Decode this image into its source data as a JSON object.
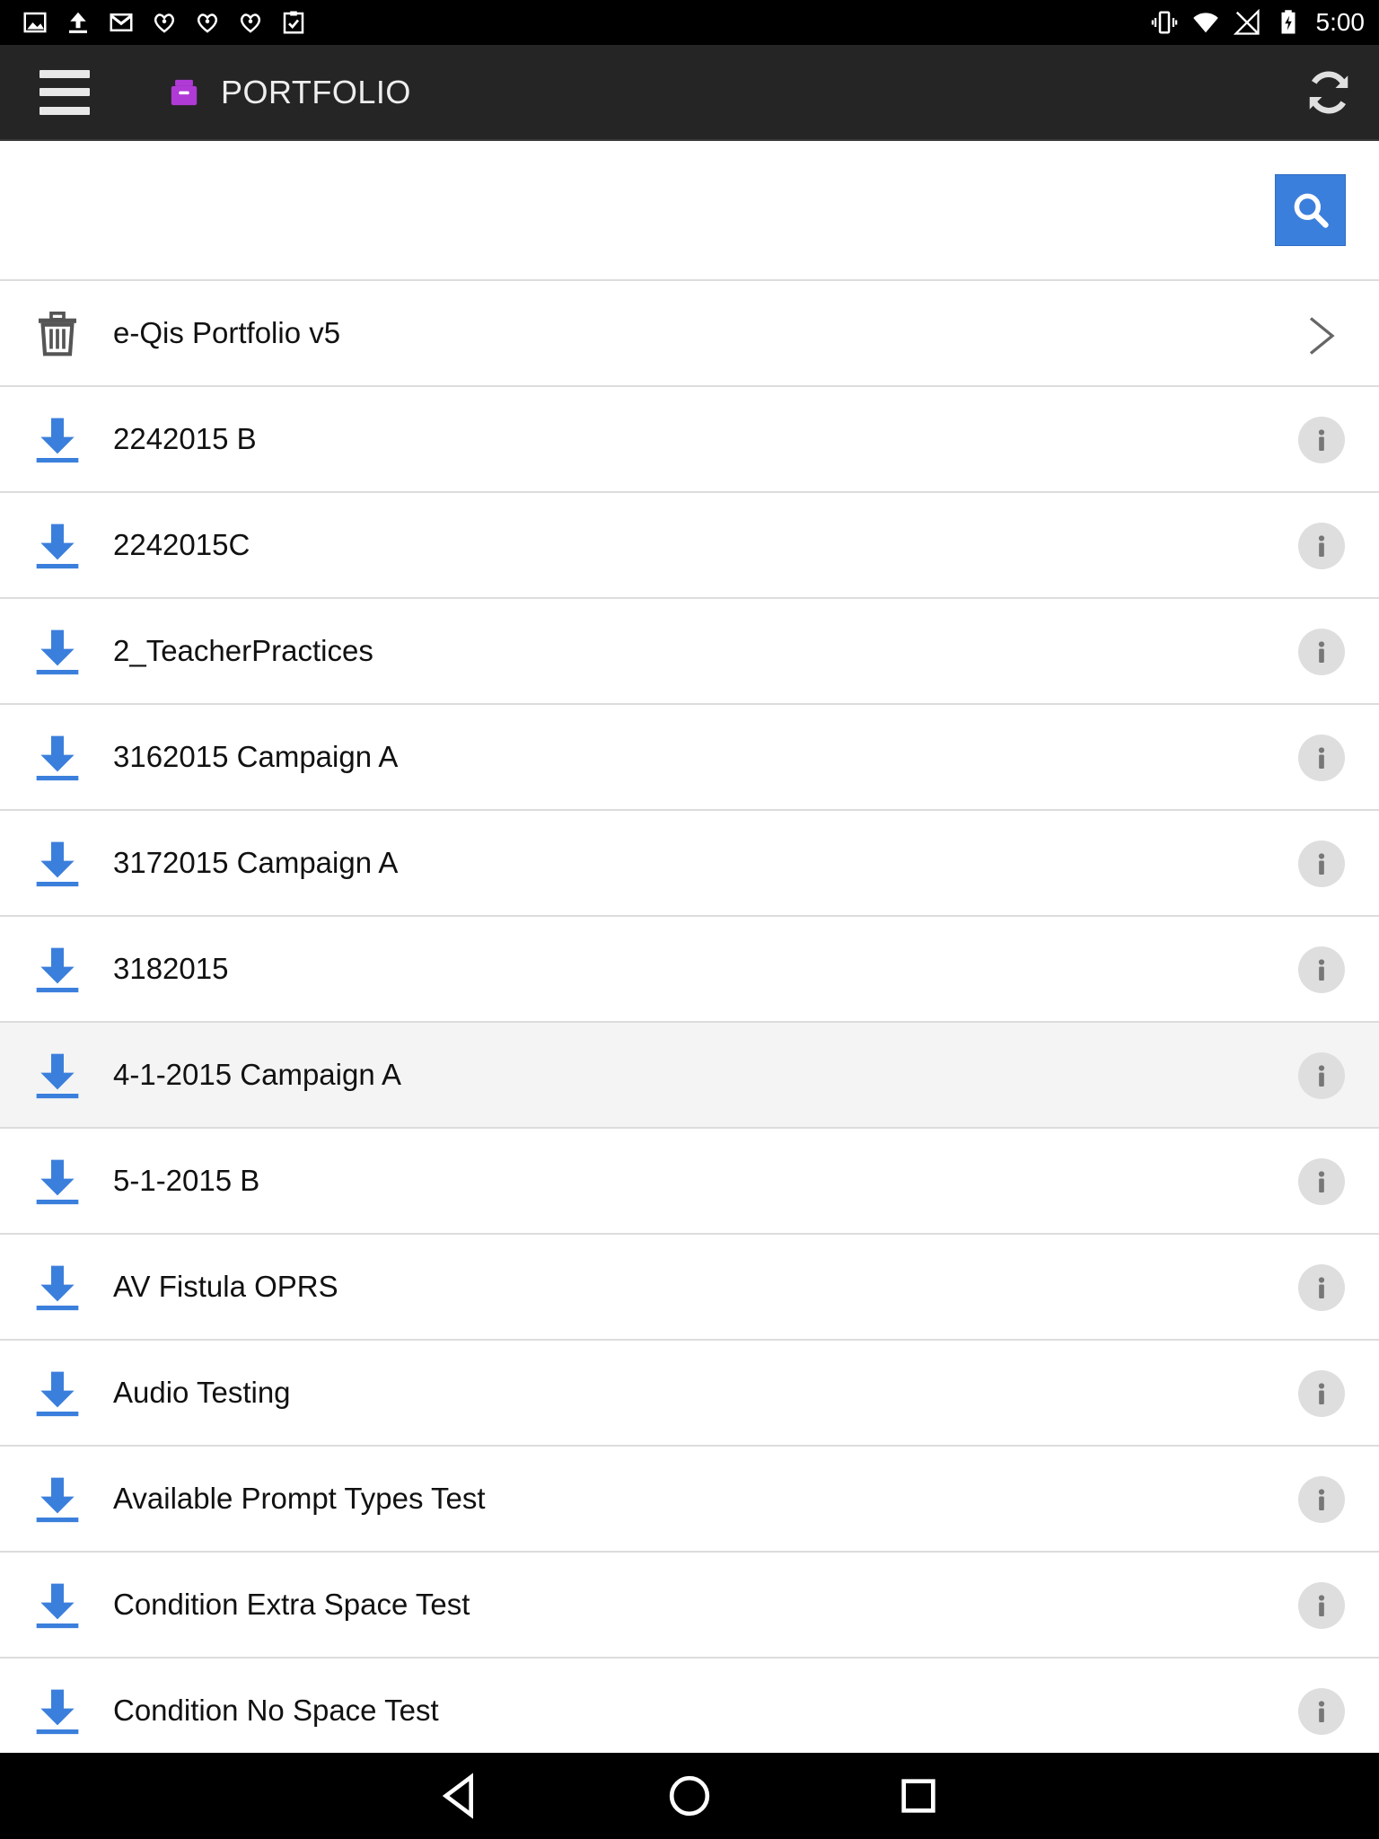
{
  "status_bar": {
    "time": "5:00",
    "left_icons": [
      "image-icon",
      "upload-icon",
      "gmail-icon",
      "iheartradio-icon",
      "iheartradio-icon",
      "iheartradio-icon",
      "clipboard-check-icon"
    ],
    "right_icons": [
      "vibrate-icon",
      "wifi-icon",
      "no-signal-icon",
      "battery-charging-icon"
    ]
  },
  "app_bar": {
    "title": "PORTFOLIO",
    "menu_icon": "hamburger-icon",
    "logo_icon": "archive-box-icon",
    "refresh_icon": "refresh-icon"
  },
  "search": {
    "value": "",
    "placeholder": "",
    "button_icon": "search-icon"
  },
  "portfolio_header": {
    "label": "e-Qis Portfolio v5",
    "left_icon": "trash-icon",
    "right_icon": "chevron-right-icon"
  },
  "items": [
    {
      "label": "2242015 B",
      "highlighted": false
    },
    {
      "label": "2242015C",
      "highlighted": false
    },
    {
      "label": "2_TeacherPractices",
      "highlighted": false
    },
    {
      "label": "3162015 Campaign A",
      "highlighted": false
    },
    {
      "label": "3172015 Campaign A",
      "highlighted": false
    },
    {
      "label": "3182015",
      "highlighted": false
    },
    {
      "label": "4-1-2015 Campaign A",
      "highlighted": true
    },
    {
      "label": "5-1-2015 B",
      "highlighted": false
    },
    {
      "label": "AV Fistula OPRS",
      "highlighted": false
    },
    {
      "label": "Audio Testing",
      "highlighted": false
    },
    {
      "label": "Available Prompt Types Test",
      "highlighted": false
    },
    {
      "label": "Condition Extra Space Test",
      "highlighted": false
    },
    {
      "label": "Condition No Space Test",
      "highlighted": false
    }
  ],
  "item_icons": {
    "left": "download-icon",
    "right": "info-icon"
  },
  "nav_bar": {
    "icons": [
      "back-icon",
      "home-icon",
      "recents-icon"
    ]
  },
  "colors": {
    "app_bar": "#252525",
    "accent_blue": "#3b7fdc",
    "logo_purple": "#b03ad6",
    "highlight_row": "#f4f4f4",
    "info_bg": "#dedede"
  }
}
